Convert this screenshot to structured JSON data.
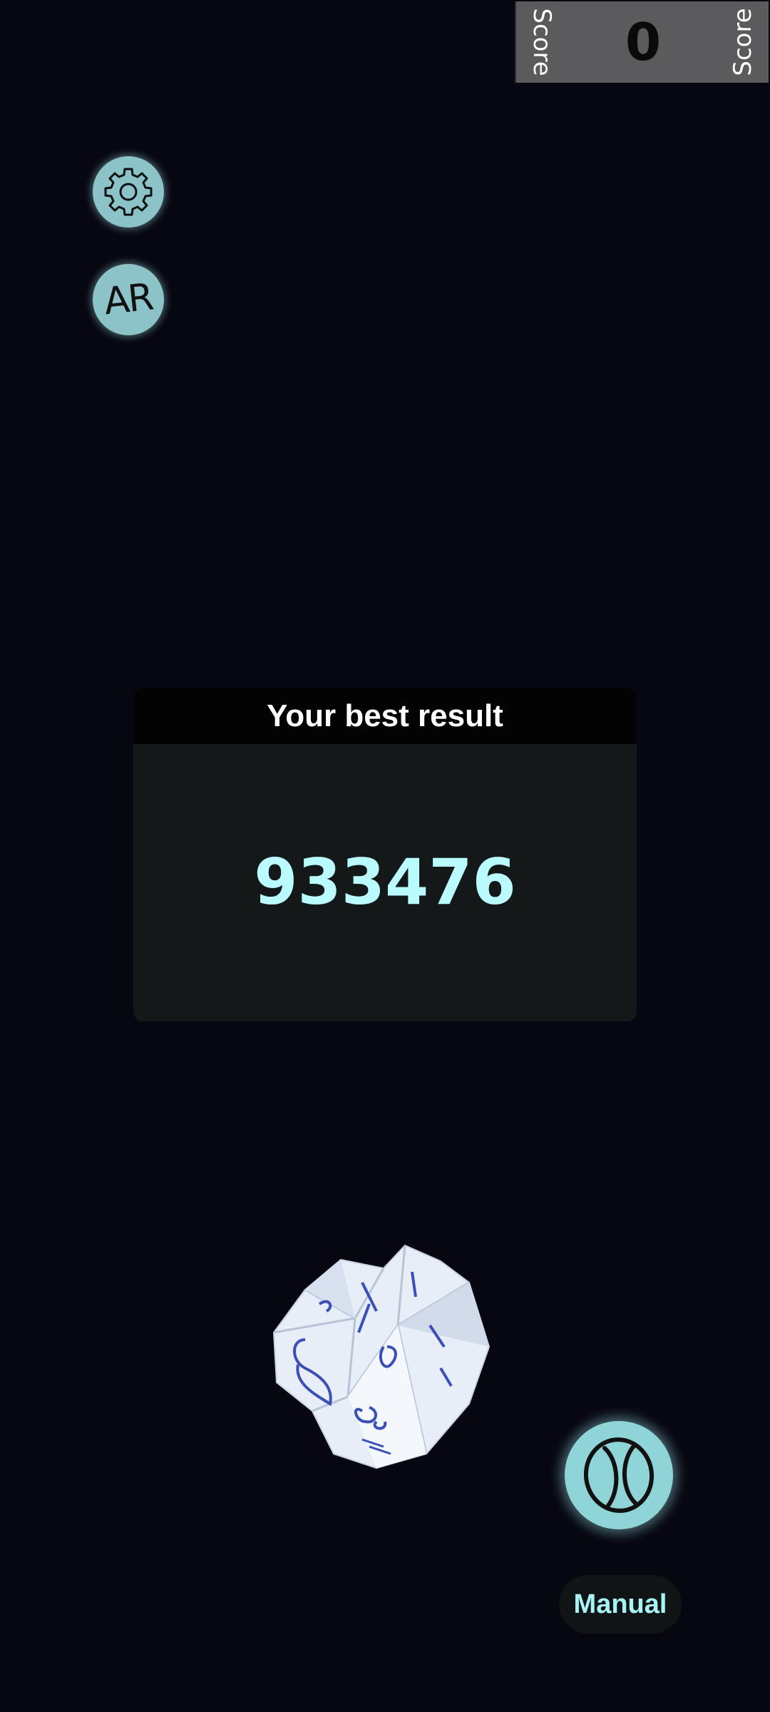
{
  "score": {
    "label_left": "Score",
    "label_right": "Score",
    "value": "0"
  },
  "buttons": {
    "settings_icon": "gear-icon",
    "ar_label": "AR",
    "throw_icon": "ball-icon",
    "manual_label": "Manual"
  },
  "best_result": {
    "title": "Your best result",
    "value": "933476"
  },
  "colors": {
    "background": "#070711",
    "accent": "#8bc3c8",
    "best_value": "#b9fbff",
    "score_panel": "#5b5b5d"
  }
}
